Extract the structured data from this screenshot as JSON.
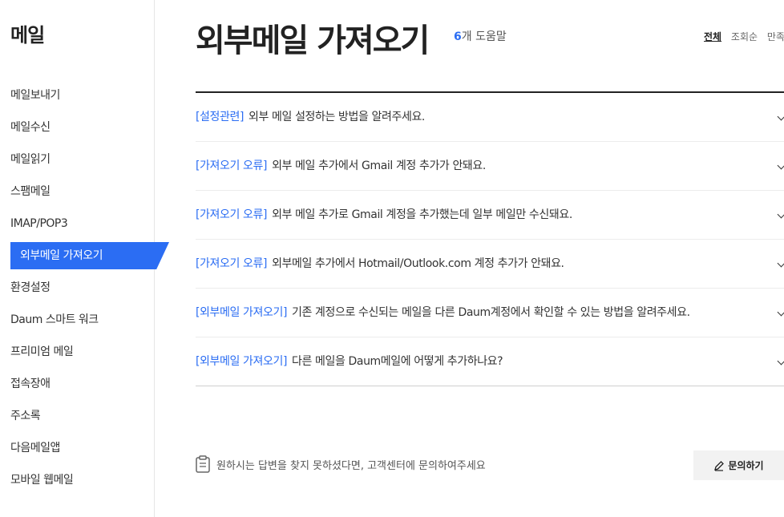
{
  "sidebar": {
    "title": "메일",
    "items": [
      {
        "label": "메일보내기"
      },
      {
        "label": "메일수신"
      },
      {
        "label": "메일읽기"
      },
      {
        "label": "스팸메일"
      },
      {
        "label": "IMAP/POP3"
      },
      {
        "label": "외부메일 가져오기",
        "active": true
      },
      {
        "label": "환경설정"
      },
      {
        "label": "Daum 스마트 워크"
      },
      {
        "label": "프리미엄 메일"
      },
      {
        "label": "접속장애"
      },
      {
        "label": "주소록"
      },
      {
        "label": "다음메일앱"
      },
      {
        "label": "모바일 웹메일"
      }
    ]
  },
  "main": {
    "title": "외부메일 가져오기",
    "count_num": "6",
    "count_label": "개 도움말",
    "sort": [
      "전체",
      "조회순",
      "만족"
    ],
    "faqs": [
      {
        "category": "[설정관련]",
        "text": "외부 메일 설정하는 방법을 알려주세요."
      },
      {
        "category": "[가져오기 오류]",
        "text": "외부 메일 추가에서 Gmail 계정 추가가 안돼요."
      },
      {
        "category": "[가져오기 오류]",
        "text": "외부 메일 추가로 Gmail 계정을 추가했는데 일부 메일만 수신돼요."
      },
      {
        "category": "[가져오기 오류]",
        "text": "외부메일 추가에서 Hotmail/Outlook.com 계정 추가가 안돼요."
      },
      {
        "category": "[외부메일 가져오기]",
        "text": "기존 계정으로 수신되는 메일을 다른 Daum계정에서 확인할 수 있는 방법을 알려주세요."
      },
      {
        "category": "[외부메일 가져오기]",
        "text": "다른 메일을 Daum메일에 어떻게 추가하나요?"
      }
    ],
    "footer_note": "원하시는 답변을 찾지 못하셨다면, 고객센터에 문의하여주세요",
    "inquiry_label": "문의하기"
  },
  "colors": {
    "accent": "#2b6df3"
  }
}
